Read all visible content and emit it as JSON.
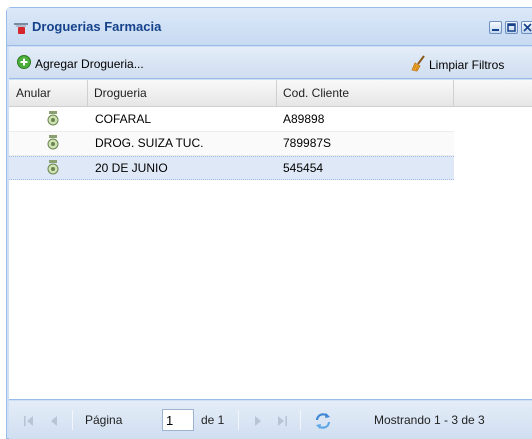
{
  "window": {
    "title": "Droguerias Farmacia"
  },
  "toolbar": {
    "add_label": "Agregar Drogueria...",
    "clear_label": "Limpiar Filtros"
  },
  "grid": {
    "columns": [
      "Anular",
      "Drogueria",
      "Cod. Cliente",
      ""
    ],
    "rows": [
      {
        "drogueria": "COFARAL",
        "cod_cliente": "A89898",
        "selected": false
      },
      {
        "drogueria": "DROG. SUIZA TUC.",
        "cod_cliente": "789987S",
        "selected": false
      },
      {
        "drogueria": "20 DE JUNIO",
        "cod_cliente": "545454",
        "selected": true
      }
    ],
    "row_icon": "cancel-badge-icon"
  },
  "pager": {
    "page_label": "Página",
    "page_value": "1",
    "of_label": "de 1",
    "display_info": "Mostrando 1 - 3 de 3"
  },
  "colors": {
    "title_text": "#15428b",
    "frame_border": "#99bbe8",
    "selected_row": "#dfe8f6",
    "add_icon_green": "#4caf3c"
  }
}
